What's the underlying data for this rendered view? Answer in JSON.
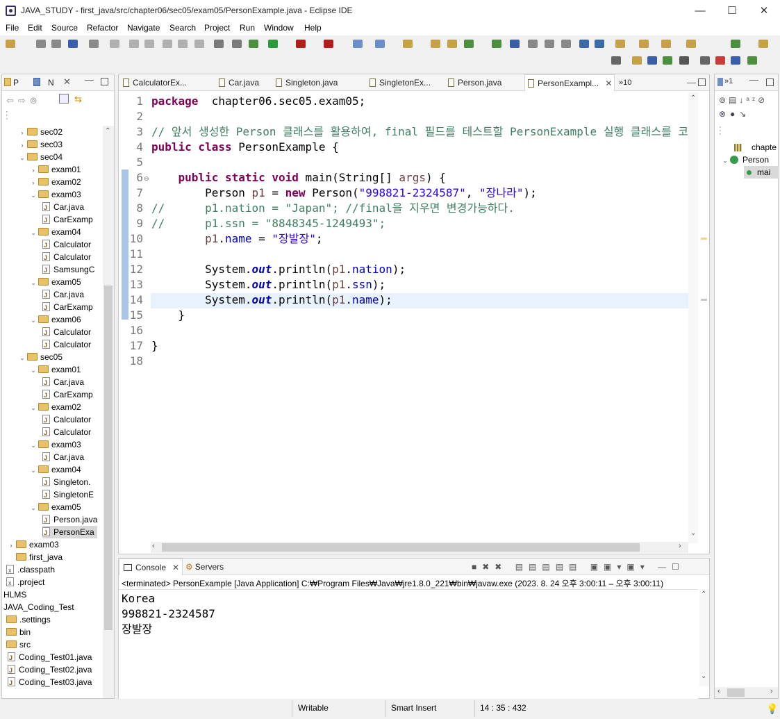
{
  "window": {
    "title": "JAVA_STUDY - first_java/src/chapter06/sec05/exam05/PersonExample.java - Eclipse IDE",
    "min": "—",
    "max": "☐",
    "close": "✕"
  },
  "menu": [
    "File",
    "Edit",
    "Source",
    "Refactor",
    "Navigate",
    "Search",
    "Project",
    "Run",
    "Window",
    "Help"
  ],
  "left_panel": {
    "tabs": [
      "P",
      "N"
    ],
    "tree": [
      {
        "indent": 1,
        "exp": "›",
        "kind": "folder",
        "label": "sec02"
      },
      {
        "indent": 1,
        "exp": "›",
        "kind": "folder",
        "label": "sec03"
      },
      {
        "indent": 1,
        "exp": "⌄",
        "kind": "folder",
        "label": "sec04"
      },
      {
        "indent": 2,
        "exp": "›",
        "kind": "folder",
        "label": "exam01"
      },
      {
        "indent": 2,
        "exp": "›",
        "kind": "folder",
        "label": "exam02"
      },
      {
        "indent": 2,
        "exp": "⌄",
        "kind": "folder",
        "label": "exam03"
      },
      {
        "indent": 3,
        "exp": "",
        "kind": "java",
        "label": "Car.java"
      },
      {
        "indent": 3,
        "exp": "",
        "kind": "java",
        "label": "CarExamp"
      },
      {
        "indent": 2,
        "exp": "⌄",
        "kind": "folder",
        "label": "exam04"
      },
      {
        "indent": 3,
        "exp": "",
        "kind": "java",
        "label": "Calculator"
      },
      {
        "indent": 3,
        "exp": "",
        "kind": "java",
        "label": "Calculator"
      },
      {
        "indent": 3,
        "exp": "",
        "kind": "java",
        "label": "SamsungC"
      },
      {
        "indent": 2,
        "exp": "⌄",
        "kind": "folder",
        "label": "exam05"
      },
      {
        "indent": 3,
        "exp": "",
        "kind": "java",
        "label": "Car.java"
      },
      {
        "indent": 3,
        "exp": "",
        "kind": "java",
        "label": "CarExamp"
      },
      {
        "indent": 2,
        "exp": "⌄",
        "kind": "folder",
        "label": "exam06"
      },
      {
        "indent": 3,
        "exp": "",
        "kind": "java",
        "label": "Calculator"
      },
      {
        "indent": 3,
        "exp": "",
        "kind": "java",
        "label": "Calculator"
      },
      {
        "indent": 1,
        "exp": "⌄",
        "kind": "folder",
        "label": "sec05"
      },
      {
        "indent": 2,
        "exp": "⌄",
        "kind": "folder",
        "label": "exam01"
      },
      {
        "indent": 3,
        "exp": "",
        "kind": "java",
        "label": "Car.java"
      },
      {
        "indent": 3,
        "exp": "",
        "kind": "java",
        "label": "CarExamp"
      },
      {
        "indent": 2,
        "exp": "⌄",
        "kind": "folder",
        "label": "exam02"
      },
      {
        "indent": 3,
        "exp": "",
        "kind": "java",
        "label": "Calculator"
      },
      {
        "indent": 3,
        "exp": "",
        "kind": "java",
        "label": "Calculator"
      },
      {
        "indent": 2,
        "exp": "⌄",
        "kind": "folder",
        "label": "exam03"
      },
      {
        "indent": 3,
        "exp": "",
        "kind": "java",
        "label": "Car.java"
      },
      {
        "indent": 2,
        "exp": "⌄",
        "kind": "folder",
        "label": "exam04"
      },
      {
        "indent": 3,
        "exp": "",
        "kind": "java",
        "label": "Singleton."
      },
      {
        "indent": 3,
        "exp": "",
        "kind": "java",
        "label": "SingletonE"
      },
      {
        "indent": 2,
        "exp": "⌄",
        "kind": "folder",
        "label": "exam05"
      },
      {
        "indent": 3,
        "exp": "",
        "kind": "java",
        "label": "Person.java"
      },
      {
        "indent": 3,
        "exp": "",
        "kind": "java",
        "label": "PersonExa",
        "selected": true
      },
      {
        "indent": 0,
        "exp": "›",
        "kind": "folder",
        "label": "exam03"
      },
      {
        "indent": 0,
        "exp": "",
        "kind": "folder",
        "label": "first_java"
      },
      {
        "indent": -1,
        "exp": "",
        "kind": "x",
        "label": ".classpath"
      },
      {
        "indent": -1,
        "exp": "",
        "kind": "x",
        "label": ".project"
      },
      {
        "indent": -2,
        "exp": "",
        "kind": "plain",
        "label": "HLMS"
      },
      {
        "indent": -2,
        "exp": "",
        "kind": "plain",
        "label": "JAVA_Coding_Test"
      },
      {
        "indent": -1,
        "exp": "",
        "kind": "folder",
        "label": ".settings"
      },
      {
        "indent": -1,
        "exp": "",
        "kind": "folder",
        "label": "bin"
      },
      {
        "indent": -1,
        "exp": "",
        "kind": "folder",
        "label": "src"
      },
      {
        "indent": 0,
        "exp": "",
        "kind": "java",
        "label": "Coding_Test01.java"
      },
      {
        "indent": 0,
        "exp": "",
        "kind": "java",
        "label": "Coding_Test02.java"
      },
      {
        "indent": 0,
        "exp": "",
        "kind": "java",
        "label": "Coding_Test03.java"
      }
    ]
  },
  "editor": {
    "tabs": [
      {
        "label": "CalculatorEx..."
      },
      {
        "label": "Car.java"
      },
      {
        "label": "Singleton.java"
      },
      {
        "label": "SingletonEx..."
      },
      {
        "label": "Person.java"
      },
      {
        "label": "PersonExampl...",
        "active": true
      }
    ],
    "overflow": "»10",
    "line_numbers": [
      "1",
      "2",
      "3",
      "4",
      "5",
      "6",
      "7",
      "8",
      "9",
      "10",
      "11",
      "12",
      "13",
      "14",
      "15",
      "16",
      "17",
      "18"
    ],
    "lines": [
      [
        [
          "kw",
          "package"
        ],
        [
          "",
          "  chapter06.sec05.exam05;"
        ]
      ],
      [],
      [
        [
          "cmt",
          "// 앞서 생성한 Person 클래스를 활용하여, final 필드를 테스트할 PersonExample 실행 클래스를 코딩"
        ]
      ],
      [
        [
          "kw",
          "public class"
        ],
        [
          "",
          " PersonExample {"
        ]
      ],
      [],
      [
        [
          "",
          "    "
        ],
        [
          "kw",
          "public static void"
        ],
        [
          "",
          " main(String[] "
        ],
        [
          "var",
          "args"
        ],
        [
          "",
          ") {"
        ]
      ],
      [
        [
          "",
          "        Person "
        ],
        [
          "var",
          "p1"
        ],
        [
          "",
          " = "
        ],
        [
          "kw",
          "new"
        ],
        [
          "",
          " Person("
        ],
        [
          "str",
          "\"998821-2324587\""
        ],
        [
          "",
          ", "
        ],
        [
          "str",
          "\"장나라\""
        ],
        [
          "",
          ");"
        ]
      ],
      [
        [
          "cmt",
          "//      p1.nation = \"Japan\"; //final을 지우면 변경가능하다."
        ]
      ],
      [
        [
          "cmt",
          "//      p1.ssn = \"8848345-1249493\";"
        ]
      ],
      [
        [
          "",
          "        "
        ],
        [
          "var",
          "p1"
        ],
        [
          "",
          "."
        ],
        [
          "fld",
          "name"
        ],
        [
          "",
          " = "
        ],
        [
          "str",
          "\"장발장\""
        ],
        [
          "",
          ";"
        ]
      ],
      [],
      [
        [
          "",
          "        System."
        ],
        [
          "stf",
          "out"
        ],
        [
          "",
          ".println("
        ],
        [
          "var",
          "p1"
        ],
        [
          "",
          "."
        ],
        [
          "fld",
          "nation"
        ],
        [
          "",
          ");"
        ]
      ],
      [
        [
          "",
          "        System."
        ],
        [
          "stf",
          "out"
        ],
        [
          "",
          ".println("
        ],
        [
          "var",
          "p1"
        ],
        [
          "",
          "."
        ],
        [
          "fld",
          "ssn"
        ],
        [
          "",
          ");"
        ]
      ],
      [
        [
          "",
          "        System."
        ],
        [
          "stf",
          "out"
        ],
        [
          "",
          ".println("
        ],
        [
          "var",
          "p1"
        ],
        [
          "",
          "."
        ],
        [
          "fld",
          "name"
        ],
        [
          "",
          ");"
        ]
      ],
      [
        [
          "",
          "    }"
        ]
      ],
      [],
      [
        [
          "",
          "}"
        ]
      ],
      []
    ]
  },
  "outline": {
    "items": [
      {
        "label": "chapte"
      },
      {
        "label": "Person"
      },
      {
        "label": "mai"
      }
    ]
  },
  "console": {
    "tabs": [
      "Console",
      "Servers"
    ],
    "header": "<terminated> PersonExample [Java Application] C:₩Program Files₩Java₩jre1.8.0_221₩bin₩javaw.exe  (2023. 8. 24 오후 3:00:11 – 오후 3:00:11)",
    "output": [
      "Korea",
      "998821-2324587",
      "장발장"
    ]
  },
  "status": {
    "writable": "Writable",
    "insert": "Smart Insert",
    "position": "14 : 35 : 432"
  }
}
